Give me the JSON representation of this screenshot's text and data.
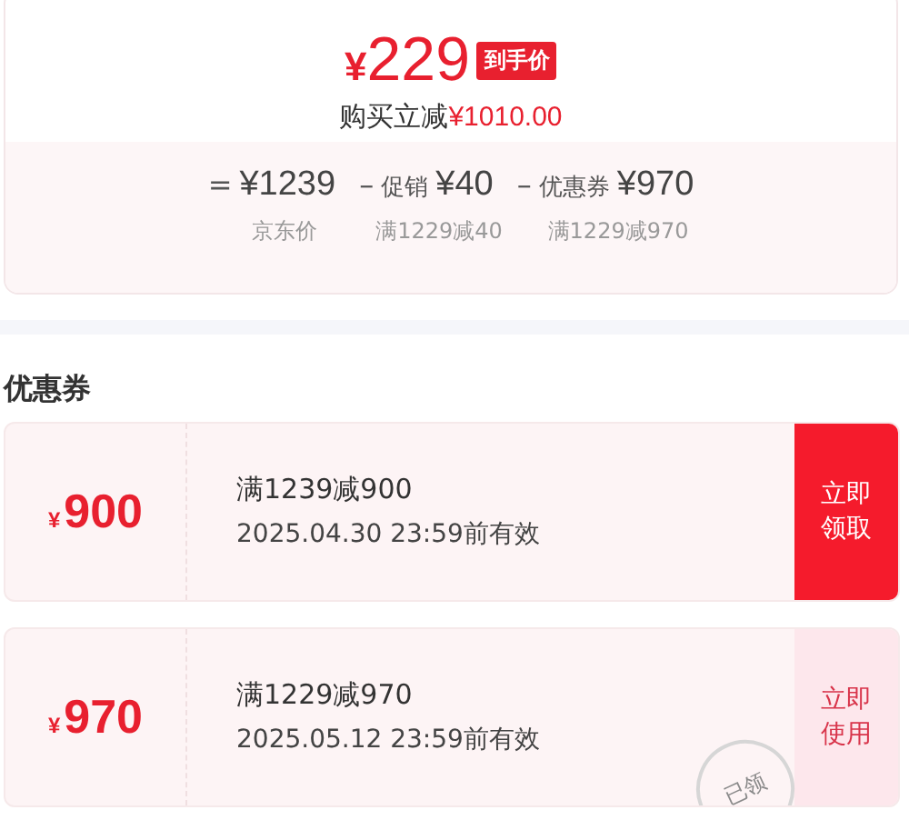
{
  "price": {
    "currency": "¥",
    "amount": "229",
    "badge": "到手价",
    "discount_label": "购买立减",
    "discount_amount": "¥1010.00"
  },
  "breakdown": [
    {
      "operator": "=",
      "amount": "¥1239",
      "note": "京东价"
    },
    {
      "operator": "–",
      "prefix": "促销",
      "amount": "¥40",
      "note": "满1229减40"
    },
    {
      "operator": "–",
      "prefix": "优惠券",
      "amount": "¥970",
      "note": "满1229减970"
    }
  ],
  "coupons_section": {
    "title": "优惠券",
    "coupons": [
      {
        "currency": "¥",
        "value": "900",
        "condition": "满1239减900",
        "validity": "2025.04.30 23:59前有效",
        "action": "立即领取",
        "claimed": false
      },
      {
        "currency": "¥",
        "value": "970",
        "condition": "满1229减970",
        "validity": "2025.05.12 23:59前有效",
        "action": "立即使用",
        "claimed": true,
        "stamp": "已领"
      }
    ]
  }
}
